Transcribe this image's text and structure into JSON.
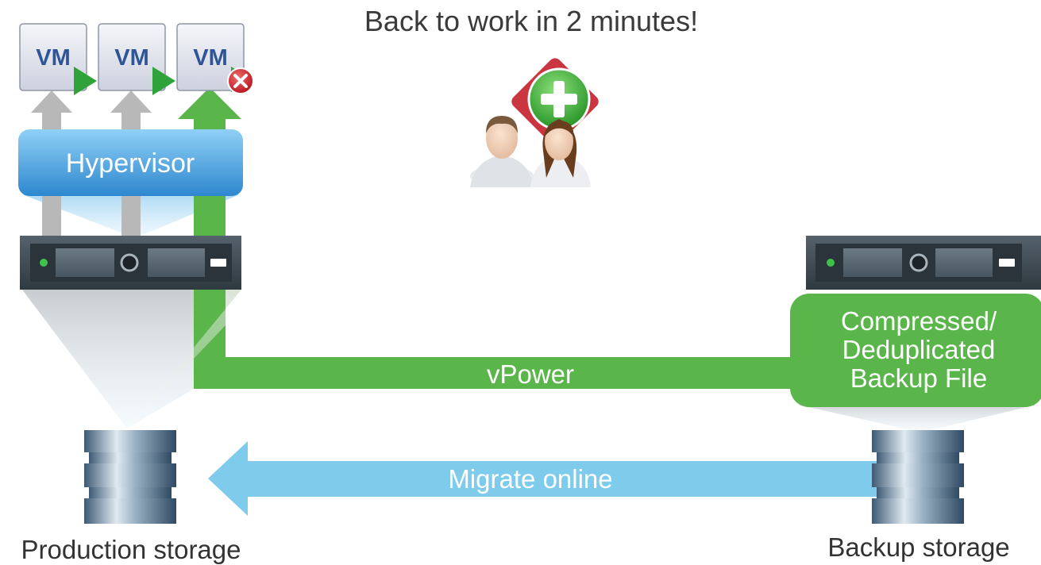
{
  "headline": "Back to work in 2 minutes!",
  "vms": [
    {
      "label": "VM",
      "status": "running"
    },
    {
      "label": "VM",
      "status": "running"
    },
    {
      "label": "VM",
      "status": "failed"
    }
  ],
  "hypervisor": {
    "label": "Hypervisor"
  },
  "backup_file": {
    "line1": "Compressed/",
    "line2": "Deduplicated",
    "line3": "Backup File"
  },
  "flows": {
    "vpower": "vPower",
    "migrate": "Migrate online"
  },
  "storage": {
    "production": "Production storage",
    "backup": "Backup storage"
  },
  "colors": {
    "green": "#5ab54a",
    "blue_arrow": "#7fcbec",
    "hypervisor_blue": "#3e97d6",
    "server_dark": "#3f4a53",
    "error_red": "#d9232a",
    "gray_arrow": "#b5b5b5",
    "vm_text": "#2f5597"
  },
  "icons": [
    "vm-icon",
    "play-icon",
    "error-icon",
    "server-icon",
    "storage-icon",
    "users-icon",
    "plus-icon"
  ]
}
